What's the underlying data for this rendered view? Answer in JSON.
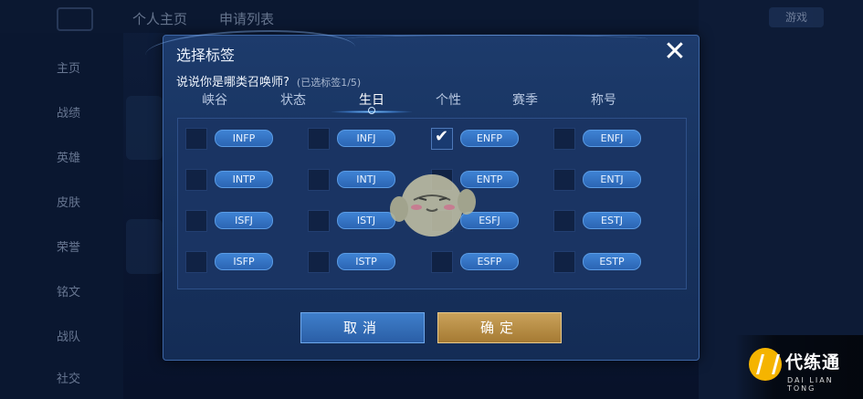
{
  "background": {
    "top_tabs": [
      "个人主页",
      "申请列表"
    ],
    "side_items": [
      "主页",
      "战绩",
      "英雄",
      "皮肤",
      "荣誉",
      "铭文",
      "战队",
      "社交"
    ],
    "right_tag": "游戏"
  },
  "dialog": {
    "title": "选择标签",
    "prompt": "说说你是哪类召唤师?",
    "selected_count": "(已选标签1/5)",
    "tabs": [
      {
        "label": "峡谷"
      },
      {
        "label": "状态"
      },
      {
        "label": "生日"
      },
      {
        "label": "个性"
      },
      {
        "label": "赛季"
      },
      {
        "label": "称号"
      }
    ],
    "active_tab": "生日",
    "tags": [
      {
        "label": "INFP",
        "checked": false
      },
      {
        "label": "INFJ",
        "checked": false
      },
      {
        "label": "ENFP",
        "checked": true
      },
      {
        "label": "ENFJ",
        "checked": false
      },
      {
        "label": "INTP",
        "checked": false
      },
      {
        "label": "INTJ",
        "checked": false
      },
      {
        "label": "ENTP",
        "checked": false
      },
      {
        "label": "ENTJ",
        "checked": false
      },
      {
        "label": "ISFJ",
        "checked": false
      },
      {
        "label": "ISTJ",
        "checked": false
      },
      {
        "label": "ESFJ",
        "checked": false
      },
      {
        "label": "ESTJ",
        "checked": false
      },
      {
        "label": "ISFP",
        "checked": false
      },
      {
        "label": "ISTP",
        "checked": false
      },
      {
        "label": "ESFP",
        "checked": false
      },
      {
        "label": "ESTP",
        "checked": false
      }
    ],
    "cancel_label": "取消",
    "confirm_label": "确定",
    "close_glyph": "✕",
    "check_glyph": "✔"
  },
  "watermark": {
    "name": "代练通",
    "sub": "DAI LIAN TONG"
  },
  "colors": {
    "dialog_bg": "#183461",
    "pill_blue": "#2b65b4",
    "confirm_gold": "#a57a33"
  }
}
